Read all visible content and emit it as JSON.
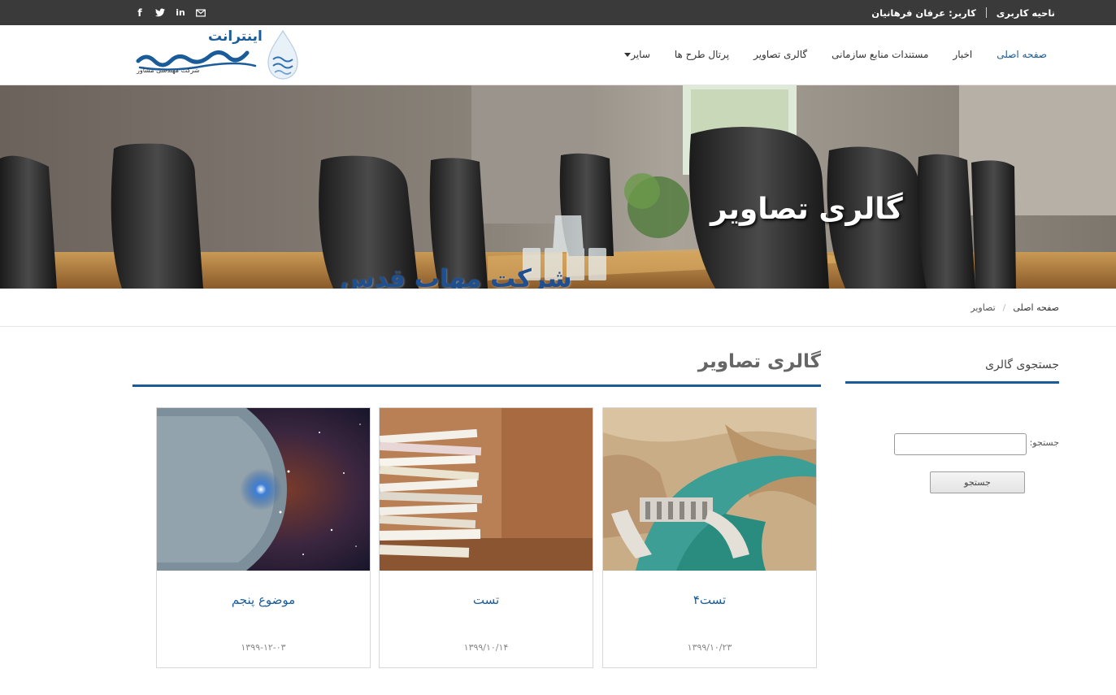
{
  "topbar": {
    "user_area": "ناحیه کاربری",
    "user": "کاربر: عرفان فرهانیان",
    "social_icons": [
      "facebook-icon",
      "twitter-icon",
      "linkedin-icon",
      "email-icon"
    ]
  },
  "logo": {
    "line1": "اینترانت",
    "line2": "مهاب قدس",
    "line3": "شرکت مهندسی مشاور"
  },
  "nav": {
    "items": [
      "صفحه اصلی",
      "اخبار",
      "مستندات منابع سازمانی",
      "گالری تصاویر",
      "پرتال طرح ها",
      "سایر"
    ]
  },
  "banner": {
    "title": "گالری تصاویر",
    "subtitle": "شرکت مهاب قدس"
  },
  "breadcrumb": {
    "home": "صفحه اصلی",
    "separator": "/",
    "current": "تصاویر"
  },
  "sidebar": {
    "title": "جستجوی گالری",
    "search_label": "جستجو:",
    "search_value": "",
    "button": "جستجو"
  },
  "main": {
    "title": "گالری تصاویر",
    "cards": [
      {
        "title": "تست۴",
        "date": "۱۳۹۹/۱۰/۲۳",
        "image": "dam"
      },
      {
        "title": "تست",
        "date": "۱۳۹۹/۱۰/۱۴",
        "image": "papers"
      },
      {
        "title": "موضوع پنجم",
        "date": "۱۳۹۹-۱۲-۰۳",
        "image": "space"
      }
    ]
  },
  "colors": {
    "accent": "#1a5c9a",
    "topbar": "#3a3a3a"
  }
}
